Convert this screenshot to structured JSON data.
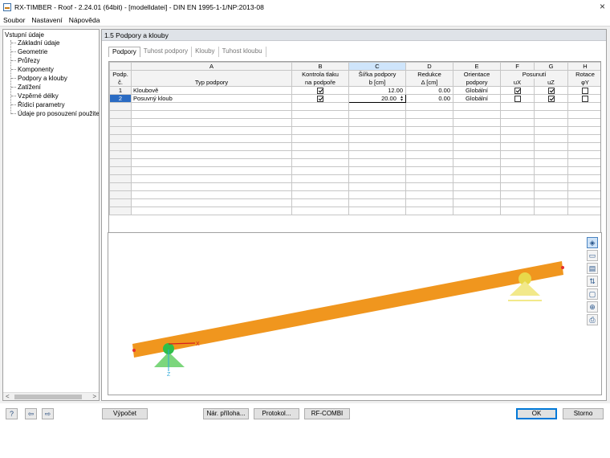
{
  "window": {
    "title": "RX-TIMBER - Roof - 2.24.01 (64bit) - [modelldatei] - DIN EN 1995-1-1/NP:2013-08",
    "close_label": "×"
  },
  "menu": [
    "Soubor",
    "Nastavení",
    "Nápověda"
  ],
  "tree": {
    "root": "Vstupní údaje",
    "items": [
      "Základní údaje",
      "Geometrie",
      "Průřezy",
      "Komponenty",
      "Podpory a klouby",
      "Zatížení",
      "Vzpěrné délky",
      "Řídicí parametry",
      "Údaje pro posouzení použitelnc"
    ],
    "selected_index": 4,
    "scroll_left": "<",
    "scroll_right": ">"
  },
  "section_title": "1.5 Podpory a klouby",
  "tabs": [
    "Podpory",
    "Tuhost podpory",
    "Klouby",
    "Tuhost kloubu"
  ],
  "table": {
    "column_letters": [
      "A",
      "B",
      "C",
      "D",
      "E",
      "F",
      "G",
      "H"
    ],
    "selected_column": "C",
    "rownum_header": [
      "Podp.",
      "č."
    ],
    "headers_row1": [
      "",
      "Kontrola tlaku",
      "Šířka podpory",
      "Redukce",
      "Orientace",
      "Posunutí",
      "",
      "Rotace"
    ],
    "headers_row2": [
      "Typ podpory",
      "na podpoře",
      "b [cm]",
      "Δ [cm]",
      "podpory",
      "uX",
      "uZ",
      "φY"
    ],
    "rows": [
      {
        "num": "1",
        "type": "Kloubově",
        "pressure_check": true,
        "width": "12.00",
        "reduction": "0.00",
        "orientation": "Globální",
        "ux": true,
        "uz": true,
        "phiy": false
      },
      {
        "num": "2",
        "type": "Posuvný kloub",
        "pressure_check": true,
        "width": "20.00",
        "reduction": "0.00",
        "orientation": "Globální",
        "ux": false,
        "uz": true,
        "phiy": false
      }
    ],
    "empty_rows": 14,
    "current_row": 1
  },
  "viewport": {
    "axis_x": "X",
    "axis_z": "Z",
    "beam_color": "#f0961e",
    "support_left_color": "#7cd67c",
    "support_right_color": "#f2e98a",
    "toolbar_icons": [
      "view-3d-icon",
      "render-icon",
      "dimension-icon",
      "axes-icon",
      "box-view-icon",
      "zoom-icon",
      "print-icon"
    ]
  },
  "buttons": {
    "calc": "Výpočet",
    "annex": "Nár. příloha...",
    "protocol": "Protokol...",
    "rfcombi": "RF-COMBI",
    "ok": "OK",
    "cancel": "Storno"
  }
}
